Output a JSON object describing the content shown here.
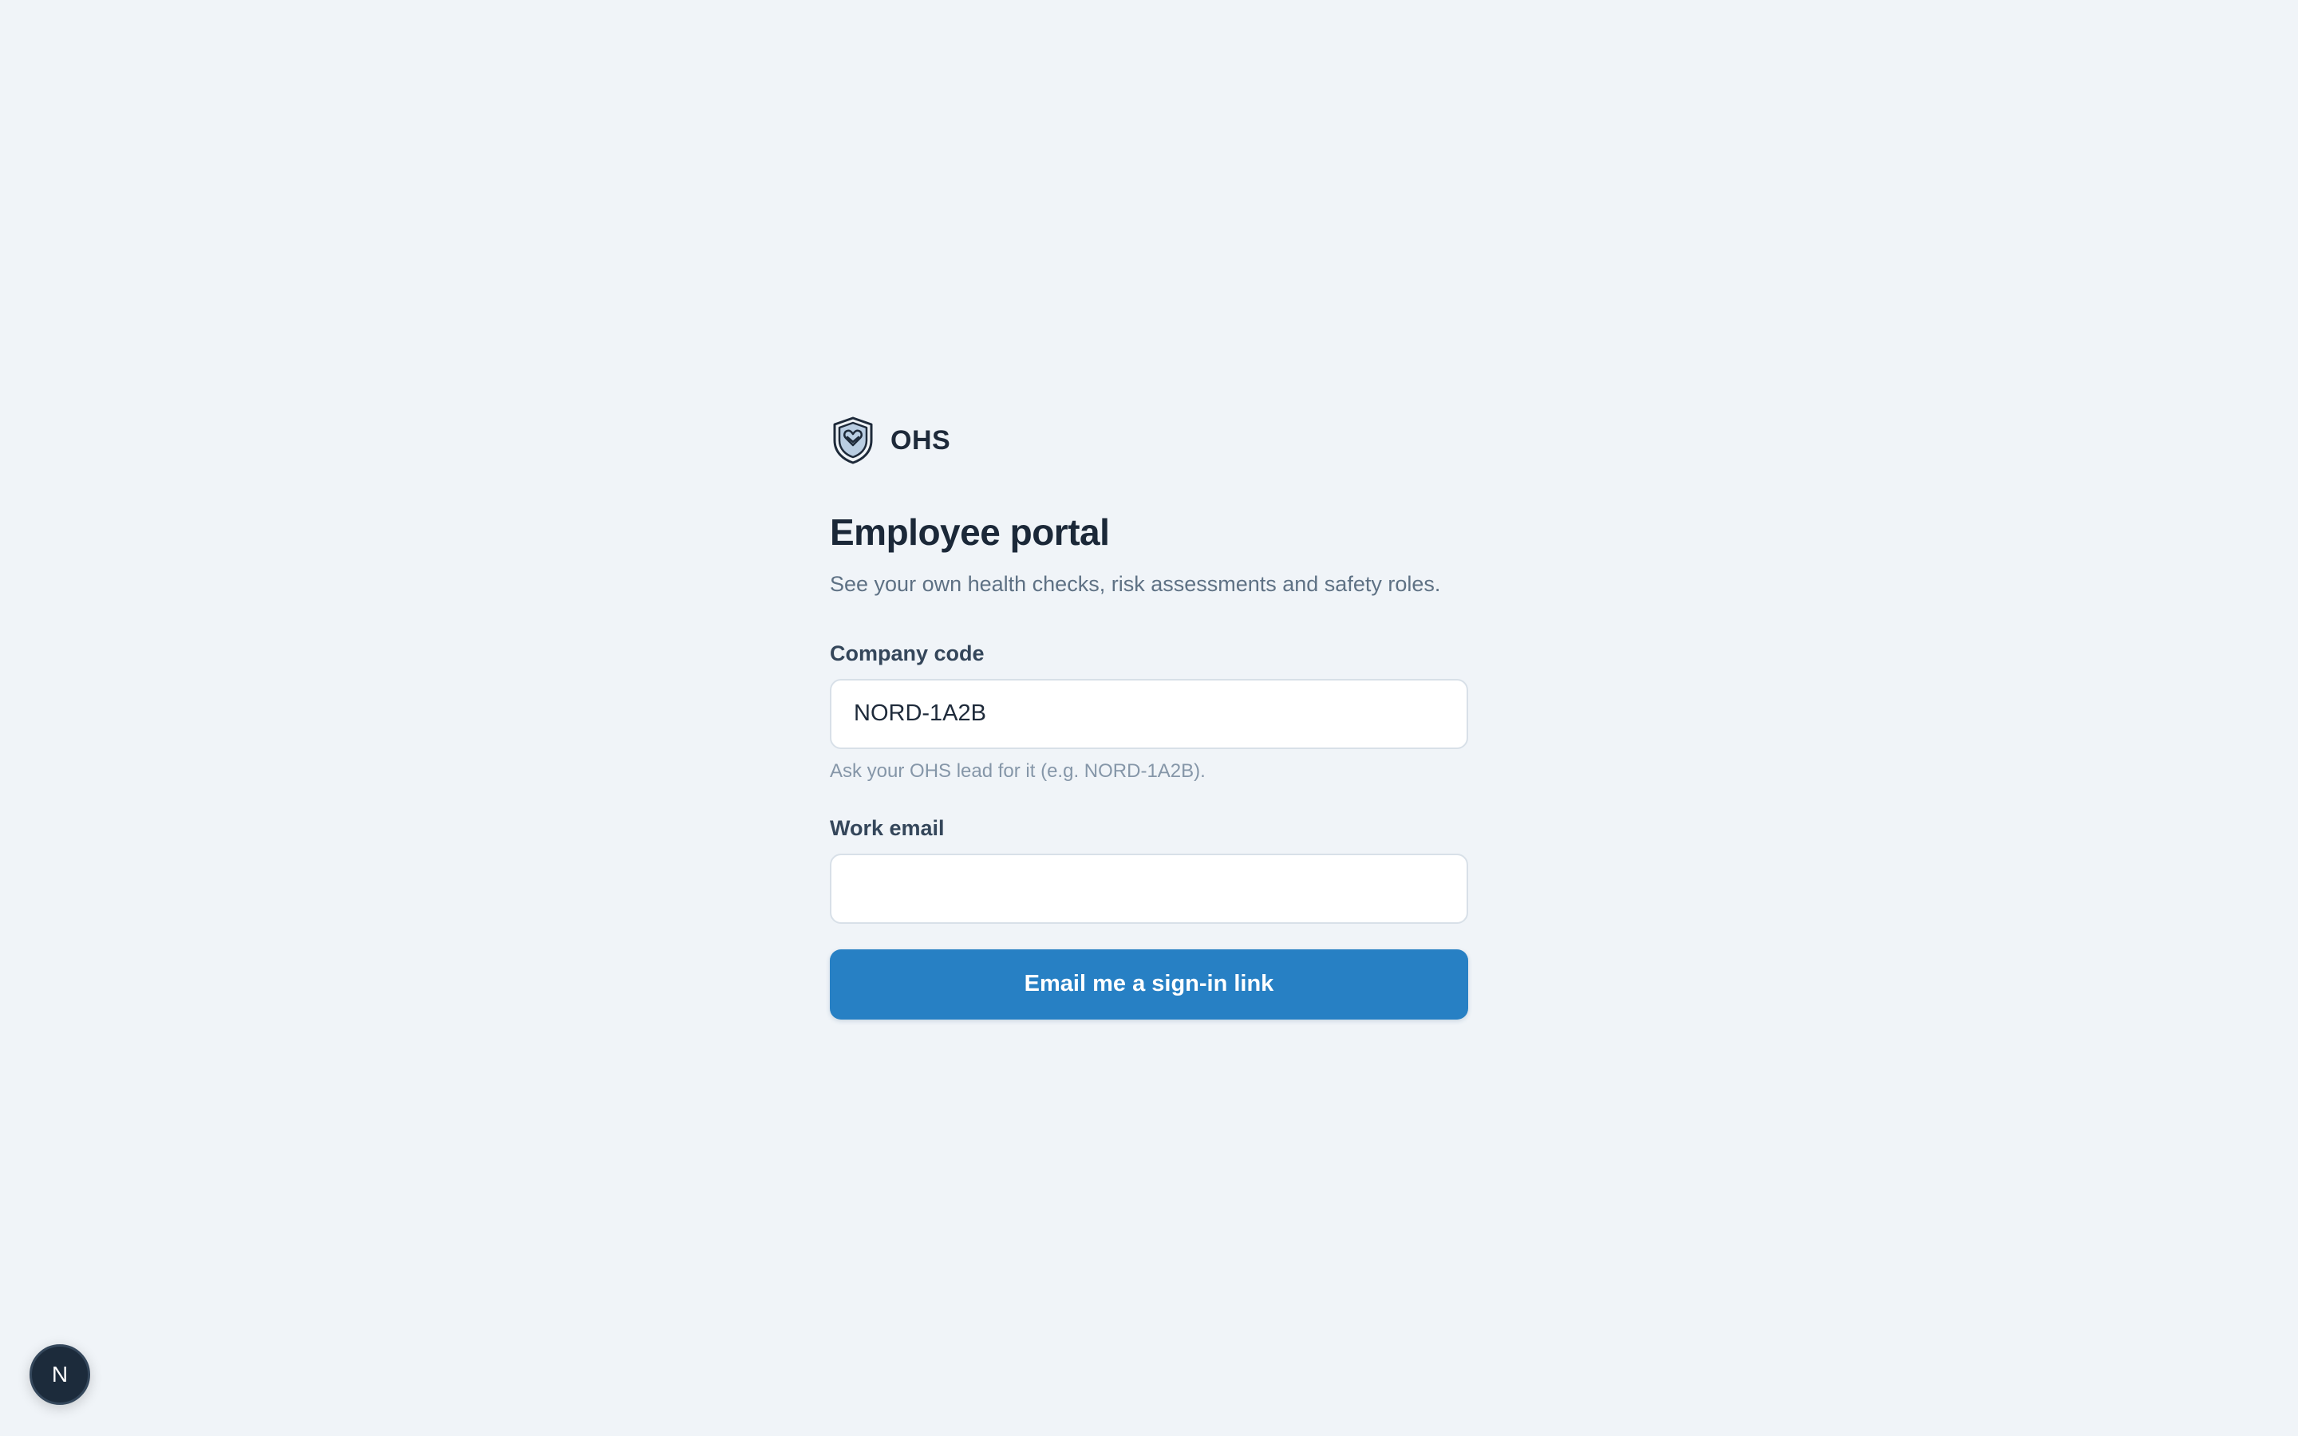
{
  "brand": {
    "name": "OHS",
    "logo_icon": "shield-heart-icon"
  },
  "login": {
    "title": "Employee portal",
    "subtitle": "See your own health checks, risk assessments and safety roles.",
    "company_code": {
      "label": "Company code",
      "value": "NORD-1A2B",
      "hint": "Ask your OHS lead for it (e.g. NORD-1A2B)."
    },
    "work_email": {
      "label": "Work email",
      "value": ""
    },
    "submit_label": "Email me a sign-in link"
  },
  "avatar": {
    "initial": "N"
  },
  "colors": {
    "background": "#f0f4f8",
    "primary": "#2780c4",
    "heading": "#1b2838",
    "muted": "#5e7184"
  }
}
